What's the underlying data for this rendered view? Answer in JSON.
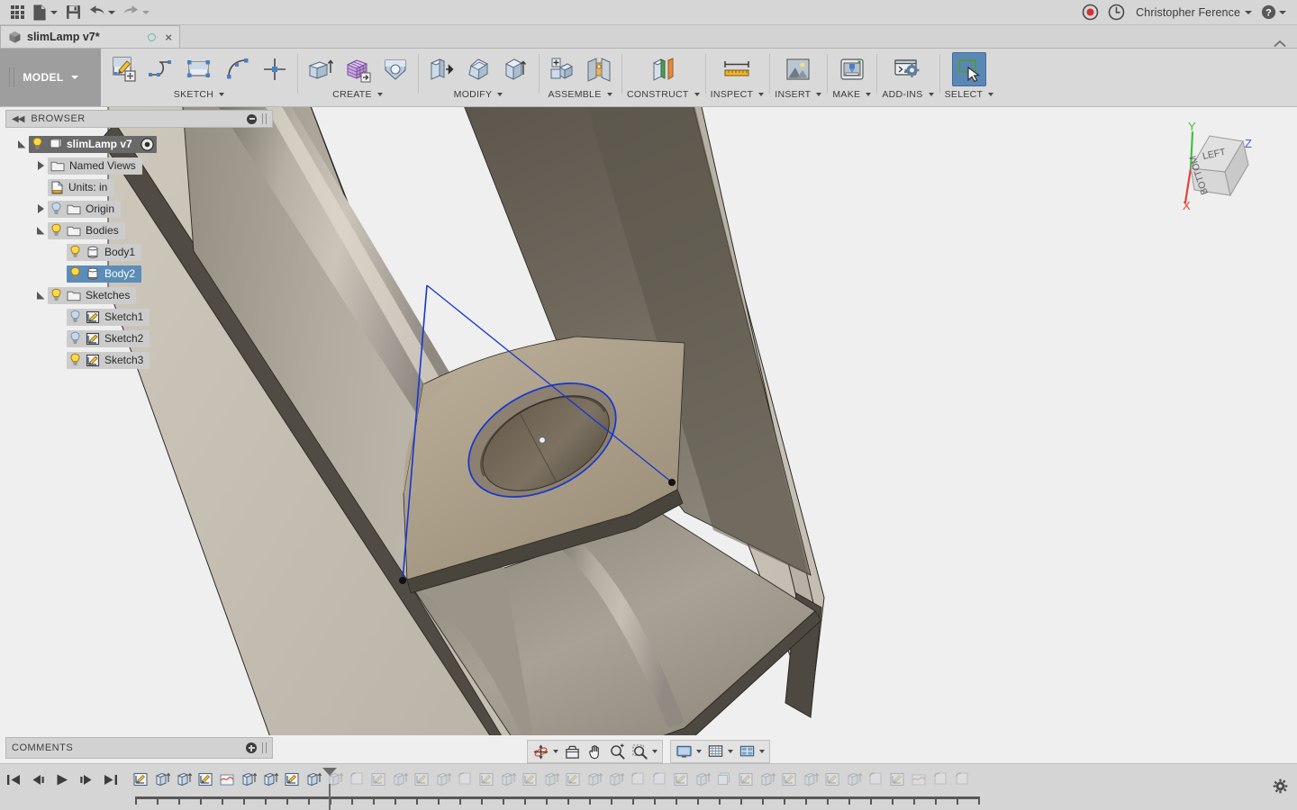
{
  "app": {
    "title": "Autodesk Fusion 360",
    "canvas_bg": "#efefef",
    "accent_blue": "#5b8db8",
    "sketch_blue": "#1436d2"
  },
  "quick_access": {
    "apps_label": "Show Data Panel",
    "file_label": "File",
    "save_label": "Save",
    "undo_label": "Undo",
    "redo_label": "Redo",
    "record_label": "Screen Record",
    "history_label": "Job Status",
    "user_name": "Christopher Ference",
    "help_label": "Help"
  },
  "tabs": [
    {
      "label": "slimLamp v7*",
      "unsaved": true,
      "active": true,
      "close_label": "×"
    }
  ],
  "ribbon": {
    "workspace": "MODEL",
    "groups": [
      {
        "label": "SKETCH",
        "name": "sketch-group",
        "items": [
          {
            "name": "create-sketch-icon",
            "label": "Create Sketch"
          },
          {
            "name": "line-icon",
            "label": "Line"
          },
          {
            "name": "rectangle-icon",
            "label": "Rectangle"
          },
          {
            "name": "spline-icon",
            "label": "Spline"
          },
          {
            "name": "construction-point-icon",
            "label": "Point"
          }
        ]
      },
      {
        "label": "CREATE",
        "name": "create-group",
        "items": [
          {
            "name": "extrude-icon",
            "label": "Extrude"
          },
          {
            "name": "mesh-box-icon",
            "label": "Create Form"
          },
          {
            "name": "hole-icon",
            "label": "Hole"
          }
        ]
      },
      {
        "label": "MODIFY",
        "name": "modify-group",
        "items": [
          {
            "name": "press-pull-icon",
            "label": "Press Pull"
          },
          {
            "name": "fillet-icon",
            "label": "Fillet"
          },
          {
            "name": "shell-icon",
            "label": "Shell"
          }
        ]
      },
      {
        "label": "ASSEMBLE",
        "name": "assemble-group",
        "items": [
          {
            "name": "new-component-icon",
            "label": "New Component"
          },
          {
            "name": "joint-icon",
            "label": "Joint"
          }
        ]
      },
      {
        "label": "CONSTRUCT",
        "name": "construct-group",
        "items": [
          {
            "name": "offset-plane-icon",
            "label": "Offset Plane"
          }
        ]
      },
      {
        "label": "INSPECT",
        "name": "inspect-group",
        "items": [
          {
            "name": "measure-icon",
            "label": "Measure"
          }
        ]
      },
      {
        "label": "INSERT",
        "name": "insert-group",
        "items": [
          {
            "name": "insert-image-icon",
            "label": "Insert Image"
          }
        ]
      },
      {
        "label": "MAKE",
        "name": "make-group",
        "items": [
          {
            "name": "3d-print-icon",
            "label": "3D Print"
          }
        ]
      },
      {
        "label": "ADD-INS",
        "name": "addins-group",
        "items": [
          {
            "name": "scripts-addins-icon",
            "label": "Scripts and Add-Ins"
          }
        ]
      },
      {
        "label": "SELECT",
        "name": "select-group",
        "active": true,
        "items": [
          {
            "name": "select-icon",
            "label": "Select"
          }
        ]
      }
    ]
  },
  "browser": {
    "title": "BROWSER",
    "collapse_label": "◀◀",
    "tree": [
      {
        "label": "slimLamp v7",
        "indent": 0,
        "arrow": "open",
        "icon": "component-icon",
        "bulb": "on",
        "root": true,
        "has_target": true
      },
      {
        "label": "Named Views",
        "indent": 1,
        "arrow": "closed",
        "icon": "folder-icon",
        "bulb": "none"
      },
      {
        "label": "Units: in",
        "indent": 1,
        "arrow": "none",
        "icon": "units-icon",
        "bulb": "none"
      },
      {
        "label": "Origin",
        "indent": 1,
        "arrow": "closed",
        "icon": "folder-icon",
        "bulb": "off"
      },
      {
        "label": "Bodies",
        "indent": 1,
        "arrow": "open",
        "icon": "folder-icon",
        "bulb": "on"
      },
      {
        "label": "Body1",
        "indent": 2,
        "arrow": "none",
        "icon": "body-icon",
        "bulb": "on"
      },
      {
        "label": "Body2",
        "indent": 2,
        "arrow": "none",
        "icon": "body-icon",
        "bulb": "on",
        "selected": true
      },
      {
        "label": "Sketches",
        "indent": 1,
        "arrow": "open",
        "icon": "folder-icon",
        "bulb": "on"
      },
      {
        "label": "Sketch1",
        "indent": 2,
        "arrow": "none",
        "icon": "sketch-icon",
        "bulb": "off"
      },
      {
        "label": "Sketch2",
        "indent": 2,
        "arrow": "none",
        "icon": "sketch-icon",
        "bulb": "off"
      },
      {
        "label": "Sketch3",
        "indent": 2,
        "arrow": "none",
        "icon": "sketch-icon",
        "bulb": "on"
      }
    ]
  },
  "comments": {
    "title": "COMMENTS",
    "add_label": "+"
  },
  "view_toolbar": {
    "groups": [
      [
        {
          "name": "orbit-icon",
          "label": "Orbit",
          "caret": true
        },
        {
          "name": "look-at-icon",
          "label": "Look At",
          "caret": false
        },
        {
          "name": "pan-icon",
          "label": "Pan",
          "caret": false
        },
        {
          "name": "zoom-icon",
          "label": "Zoom",
          "caret": false
        },
        {
          "name": "fit-icon",
          "label": "Fit",
          "caret": true
        }
      ],
      [
        {
          "name": "display-settings-icon",
          "label": "Display Settings",
          "caret": true
        },
        {
          "name": "grid-snaps-icon",
          "label": "Grid and Snaps",
          "caret": true
        },
        {
          "name": "viewports-icon",
          "label": "Viewports",
          "caret": true
        }
      ]
    ]
  },
  "viewcube": {
    "face_top": "LEFT",
    "face_front": "BOTTOM",
    "axis_x": "X",
    "axis_y": "Y",
    "axis_z": "Z",
    "axis_x_color": "#e8403a",
    "axis_y_color": "#41c13e",
    "axis_z_color": "#3f5ce0"
  },
  "timeline": {
    "playback": [
      {
        "name": "go-to-beginning-button",
        "label": "Go to Beginning"
      },
      {
        "name": "step-back-button",
        "label": "Step Back"
      },
      {
        "name": "play-button",
        "label": "Play"
      },
      {
        "name": "step-forward-button",
        "label": "Step Forward"
      },
      {
        "name": "go-to-end-button",
        "label": "Go to End"
      }
    ],
    "settings_label": "Timeline Settings",
    "marker_index": 9,
    "features": [
      {
        "type": "sketch",
        "label": "Sketch"
      },
      {
        "type": "extrude",
        "label": "Extrude"
      },
      {
        "type": "extrude",
        "label": "Extrude"
      },
      {
        "type": "sketch",
        "label": "Sketch"
      },
      {
        "type": "loft",
        "label": "Loft"
      },
      {
        "type": "extrude",
        "label": "Extrude"
      },
      {
        "type": "extrude",
        "label": "Extrude"
      },
      {
        "type": "sketch",
        "label": "Sketch"
      },
      {
        "type": "extrude",
        "label": "Extrude"
      },
      {
        "type": "extrude",
        "label": "Extrude"
      },
      {
        "type": "fillet",
        "label": "Fillet"
      },
      {
        "type": "sketch",
        "label": "Sketch"
      },
      {
        "type": "extrude",
        "label": "Extrude"
      },
      {
        "type": "sketch",
        "label": "Sketch"
      },
      {
        "type": "extrude",
        "label": "Extrude"
      },
      {
        "type": "fillet",
        "label": "Fillet"
      },
      {
        "type": "sketch",
        "label": "Sketch"
      },
      {
        "type": "extrude",
        "label": "Extrude"
      },
      {
        "type": "sketch",
        "label": "Sketch"
      },
      {
        "type": "extrude",
        "label": "Extrude"
      },
      {
        "type": "sketch",
        "label": "Sketch"
      },
      {
        "type": "extrude",
        "label": "Extrude"
      },
      {
        "type": "extrude",
        "label": "Extrude"
      },
      {
        "type": "fillet",
        "label": "Fillet"
      },
      {
        "type": "fillet",
        "label": "Fillet"
      },
      {
        "type": "sketch",
        "label": "Sketch"
      },
      {
        "type": "extrude",
        "label": "Extrude"
      },
      {
        "type": "pattern",
        "label": "Pattern"
      },
      {
        "type": "sketch",
        "label": "Sketch"
      },
      {
        "type": "extrude",
        "label": "Extrude"
      },
      {
        "type": "sketch",
        "label": "Sketch"
      },
      {
        "type": "extrude",
        "label": "Extrude"
      },
      {
        "type": "sketch",
        "label": "Sketch"
      },
      {
        "type": "extrude",
        "label": "Extrude"
      },
      {
        "type": "fillet",
        "label": "Fillet"
      },
      {
        "type": "sketch",
        "label": "Sketch"
      },
      {
        "type": "loft",
        "label": "Loft"
      },
      {
        "type": "fillet",
        "label": "Fillet"
      },
      {
        "type": "fillet",
        "label": "Fillet"
      }
    ]
  },
  "model": {
    "name": "slimLamp-3d-model",
    "description": "Extruded lamp channel body with circular cutout and active sketch",
    "body_light": "#c9c2b5",
    "body_mid": "#a9a29a",
    "body_dark": "#4a463e",
    "body_tan": "#b0a18d",
    "cavity_dark": "#6f6456"
  }
}
